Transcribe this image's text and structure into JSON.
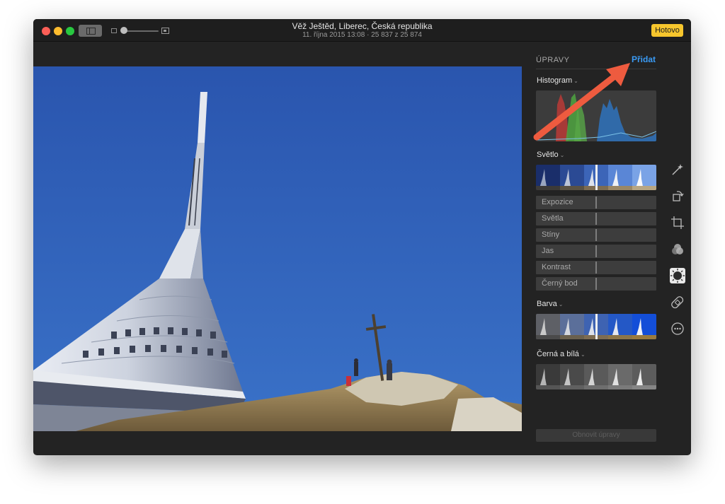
{
  "window": {
    "title": "Věž Ještěd, Liberec, Česká republika",
    "subtitle": "11. října 2015 13:08  ·  25 837 z 25 874",
    "done_label": "Hotovo"
  },
  "panel": {
    "title": "ÚPRAVY",
    "add_label": "Přidat",
    "histogram_label": "Histogram",
    "light_label": "Světlo",
    "light_sliders": [
      "Expozice",
      "Světla",
      "Stíny",
      "Jas",
      "Kontrast",
      "Černý bod"
    ],
    "color_label": "Barva",
    "bw_label": "Černá a bílá",
    "reset_label": "Obnovit úpravy"
  },
  "tools": [
    "magic-wand-icon",
    "rotate-icon",
    "crop-icon",
    "filters-icon",
    "adjust-icon",
    "retouch-bandage-icon",
    "more-icon"
  ],
  "colors": {
    "accent": "#3a9bf5",
    "done_button": "#f7c62d",
    "annotation_arrow": "#ee5b3f",
    "sky": "#2f5cb0"
  }
}
